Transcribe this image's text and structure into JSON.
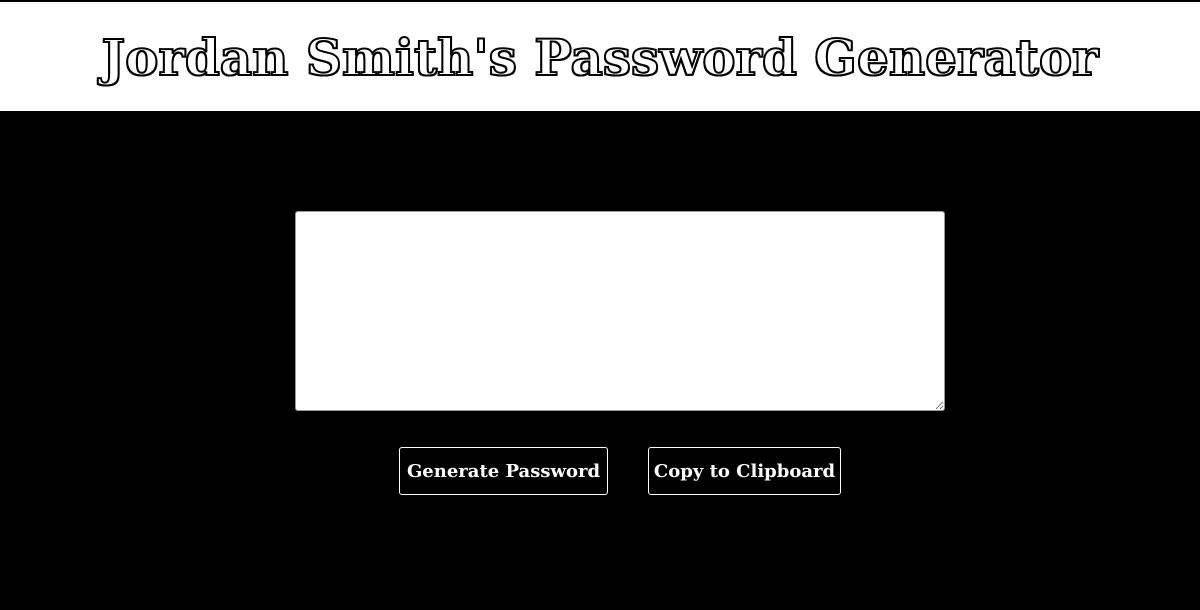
{
  "header": {
    "title": "Jordan Smith's Password Generator"
  },
  "password": {
    "value": "",
    "placeholder": ""
  },
  "buttons": {
    "generate_label": "Generate Password",
    "copy_label": "Copy to Clipboard"
  },
  "colors": {
    "background": "#000000",
    "header_background": "#ffffff",
    "button_border": "#ffffff",
    "button_text": "#ffffff"
  }
}
